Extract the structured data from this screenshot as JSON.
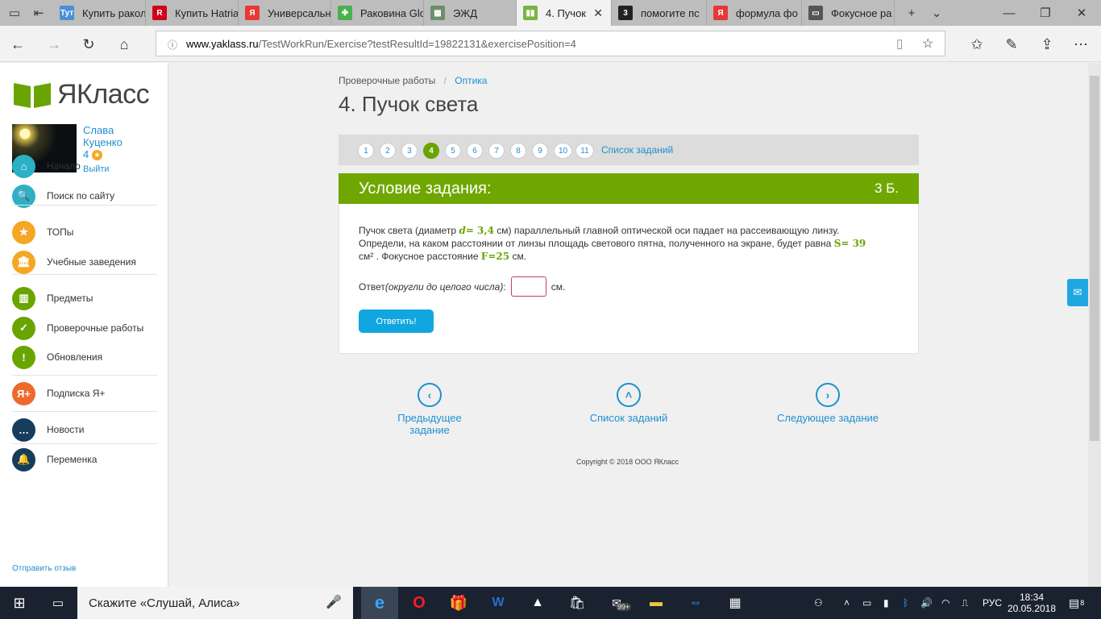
{
  "browser": {
    "tabs": [
      {
        "label": "Купить ракол",
        "favicon": "Тут",
        "color": "#4a90d9"
      },
      {
        "label": "Купить Hatria",
        "favicon": "R",
        "color": "#d0021b"
      },
      {
        "label": "Универсальн",
        "favicon": "Я",
        "color": "#e53935"
      },
      {
        "label": "Раковина Glo",
        "favicon": "✤",
        "color": "#4caf50"
      },
      {
        "label": "ЭЖД",
        "favicon": "▦",
        "color": "#6b8f6b"
      },
      {
        "label": "4. Пучок",
        "favicon": "▮▮",
        "color": "#7cb342"
      },
      {
        "label": "помогите пс",
        "favicon": "3",
        "color": "#222222"
      },
      {
        "label": "формула фо",
        "favicon": "Я",
        "color": "#e53935"
      },
      {
        "label": "Фокусное ра",
        "favicon": "▭",
        "color": "#555555"
      }
    ],
    "active_tab_close": "✕",
    "new_tab": "+",
    "tab_list": "⌄",
    "win_min": "—",
    "win_max": "❐",
    "win_close": "✕",
    "url_host": "www.yaklass.ru",
    "url_path": "/TestWorkRun/Exercise?testResultId=19822131&exercisePosition=4"
  },
  "sidebar": {
    "logo": "ЯКласс",
    "user_first": "Слава",
    "user_last": "Куценко",
    "user_points": "4",
    "logout": "Выйти",
    "menu": [
      {
        "label": "Начало",
        "icon": "home-icon",
        "color": "#2bb0c4",
        "glyph": "⌂"
      },
      {
        "label": "Поиск по сайту",
        "icon": "search-icon",
        "color": "#2bb0c4",
        "glyph": "🔍"
      },
      {
        "label": "ТОПы",
        "icon": "star-icon",
        "color": "#f5a623",
        "glyph": "★"
      },
      {
        "label": "Учебные заведения",
        "icon": "building-icon",
        "color": "#f5a623",
        "glyph": "🏛"
      },
      {
        "label": "Предметы",
        "icon": "book-icon",
        "color": "#6aa400",
        "glyph": "▥"
      },
      {
        "label": "Проверочные работы",
        "icon": "check-icon",
        "color": "#6aa400",
        "glyph": "✓"
      },
      {
        "label": "Обновления",
        "icon": "exclamation-icon",
        "color": "#6aa400",
        "glyph": "!"
      },
      {
        "label": "Подписка Я+",
        "icon": "yaplus-icon",
        "color": "#ee6a2c",
        "glyph": "Я+"
      },
      {
        "label": "Новости",
        "icon": "chat-icon",
        "color": "#163c5e",
        "glyph": "…"
      },
      {
        "label": "Переменка",
        "icon": "bell-icon",
        "color": "#163c5e",
        "glyph": "🔔"
      }
    ],
    "feedback": "Отправить отзыв"
  },
  "main": {
    "breadcrumb_1": "Проверочные работы",
    "breadcrumb_sep": "/",
    "breadcrumb_2": "Оптика",
    "title": "4. Пучок света",
    "pages": [
      "1",
      "2",
      "3",
      "4",
      "5",
      "6",
      "7",
      "8",
      "9",
      "10",
      "11"
    ],
    "current_page": "4",
    "task_list_link": "Список заданий",
    "condition_title": "Условие задания:",
    "points": "3 Б.",
    "text_1": "Пучок света (диаметр ",
    "var_d": "d",
    "val_d": "= 3,4",
    "text_2": " см) параллельный главной оптической оси падает на рассеивающую линзу.",
    "text_3": "Определи, на каком расстоянии от линзы площадь светового пятна, полученного на экране, будет равна ",
    "var_S": "S= 39",
    "text_4": "см² . Фокусное расстояние ",
    "var_F": "F=25",
    "text_5": " см.",
    "answer_label": "Ответ ",
    "answer_hint": "(округли до целого числа)",
    "answer_colon": ":",
    "answer_unit": "см.",
    "answer_value": "",
    "submit": "Ответить!",
    "prev": "Предыдущее задание",
    "list": "Список заданий",
    "next": "Следующее задание",
    "copyright": "Copyright © 2018 ООО ЯКласс"
  },
  "taskbar": {
    "search": "Скажите «Слушай, Алиса»",
    "lang": "РУС",
    "time": "18:34",
    "date": "20.05.2018",
    "notif_count": "8",
    "store_badge": "99+"
  }
}
